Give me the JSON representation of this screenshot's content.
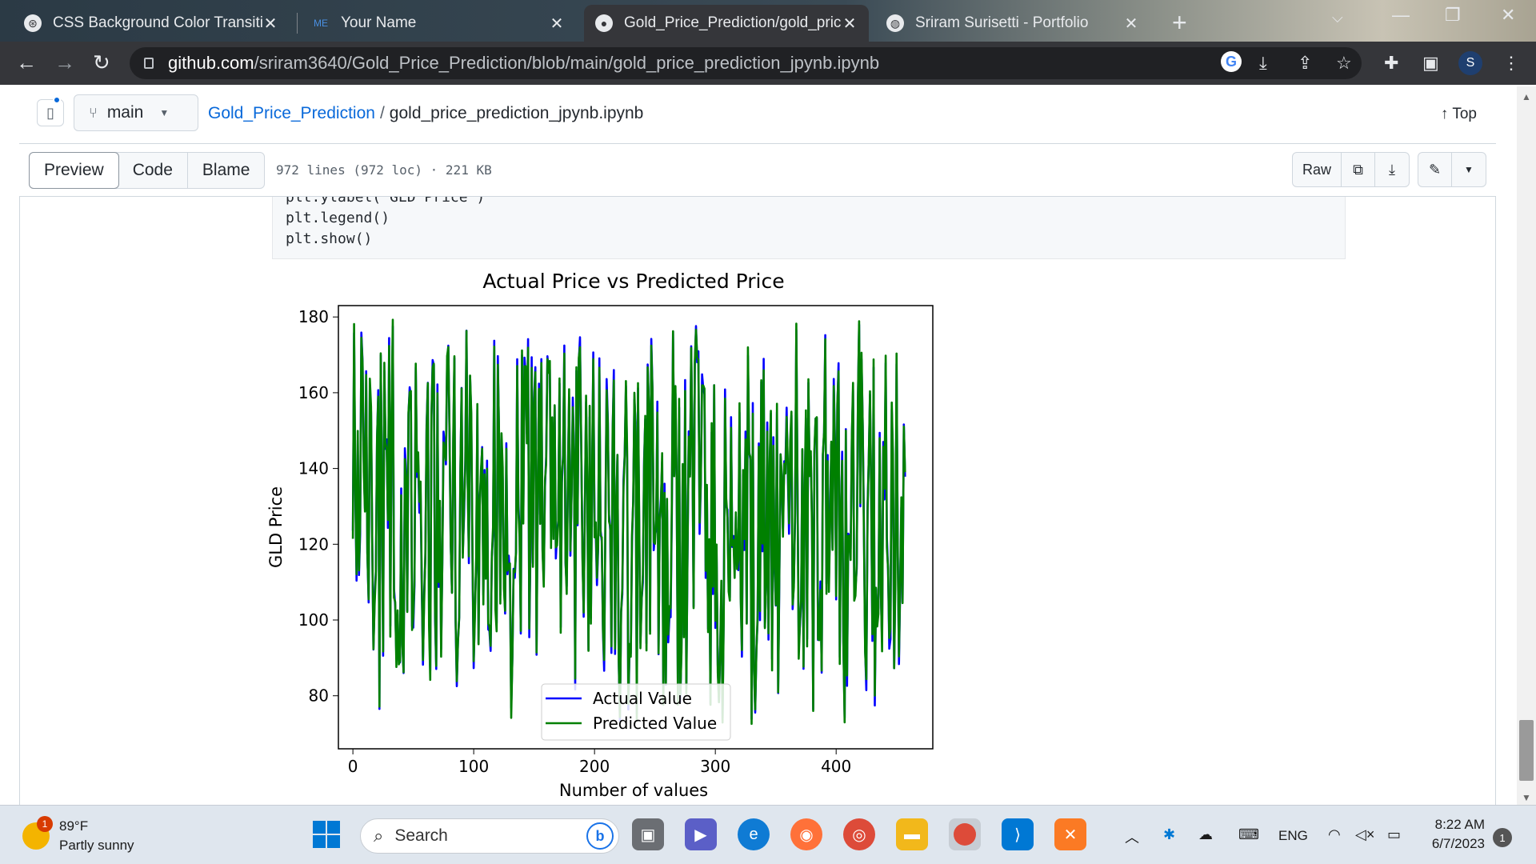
{
  "browser": {
    "tabs": [
      {
        "label": "CSS Background Color Transition",
        "icon": "chatgpt-icon"
      },
      {
        "label": "Your Name",
        "icon": "me-icon",
        "icon_text": "ME"
      },
      {
        "label": "Gold_Price_Prediction/gold_price",
        "icon": "github-icon"
      },
      {
        "label": "Sriram Surisetti - Portfolio",
        "icon": "globe-icon"
      }
    ],
    "url_host": "github.com",
    "url_path": "/sriram3640/Gold_Price_Prediction/blob/main/gold_price_prediction_jpynb.ipynb",
    "profile_initial": "S"
  },
  "github": {
    "branch": "main",
    "repo": "Gold_Price_Prediction",
    "separator": "/",
    "file": "gold_price_prediction_jpynb.ipynb",
    "top_label": "Top",
    "views": [
      "Preview",
      "Code",
      "Blame"
    ],
    "file_info": "972 lines (972 loc) · 221 KB",
    "raw_label": "Raw",
    "code_lines": [
      "plt.ylabel('GLD Price')",
      "plt.legend()",
      "plt.show()"
    ]
  },
  "chart_data": {
    "type": "line",
    "title": "Actual Price vs Predicted Price",
    "xlabel": "Number of values",
    "ylabel": "GLD Price",
    "xlim": [
      -12,
      480
    ],
    "ylim": [
      66,
      183
    ],
    "xticks": [
      0,
      100,
      200,
      300,
      400
    ],
    "yticks": [
      80,
      100,
      120,
      140,
      160,
      180
    ],
    "legend_position": "lower center",
    "series": [
      {
        "name": "Actual Value",
        "color": "#0000ff"
      },
      {
        "name": "Predicted Value",
        "color": "#008000"
      }
    ],
    "n_points": 458
  },
  "taskbar": {
    "temperature": "89°F",
    "weather": "Partly sunny",
    "weather_badge": "1",
    "search_placeholder": "Search",
    "language": "ENG",
    "time": "8:22 AM",
    "date": "6/7/2023",
    "notification_count": "1"
  }
}
